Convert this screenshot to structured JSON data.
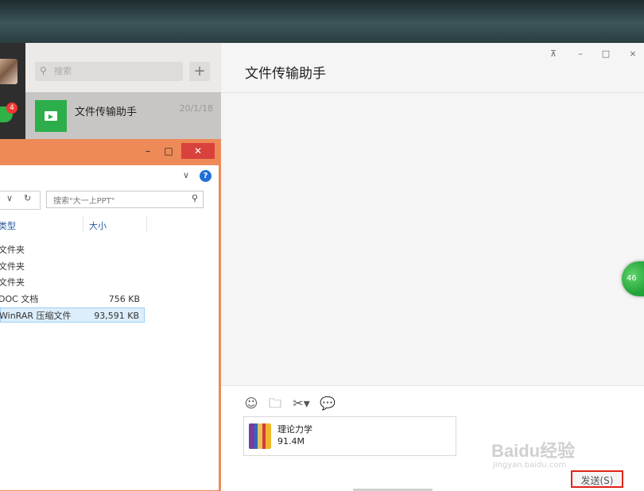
{
  "wechat": {
    "nav": {
      "badge_count": "4"
    },
    "search": {
      "placeholder": "搜索",
      "add_label": "+"
    },
    "chat_item": {
      "name": "文件传输助手",
      "date": "20/1/18"
    },
    "main": {
      "title": "文件传输助手",
      "window_controls": {
        "pin": "⊼",
        "minimize": "–",
        "maximize": "□",
        "close": "×"
      },
      "floating_badge": "46",
      "attachment": {
        "name": "理论力学",
        "size": "91.4M"
      },
      "send_label": "发送(S)"
    }
  },
  "explorer": {
    "window_controls": {
      "minimize": "–",
      "maximize": "□",
      "close": "✕"
    },
    "help_label": "?",
    "search_placeholder": "搜索\"大一上PPT\"",
    "columns": {
      "type": "类型",
      "size": "大小"
    },
    "rows": [
      {
        "type": "文件夹",
        "size": ""
      },
      {
        "type": "文件夹",
        "size": ""
      },
      {
        "type": "文件夹",
        "size": ""
      },
      {
        "type": "DOC 文档",
        "size": "756 KB"
      },
      {
        "type": "WinRAR 压缩文件",
        "size": "93,591 KB"
      }
    ]
  },
  "watermark": {
    "logo": "Baidu经验",
    "url": "jingyan.baidu.com"
  },
  "colors": {
    "accent_green": "#2cae4a",
    "explorer_frame": "#ee8a57",
    "highlight_red": "#e2231a",
    "badge_red": "#f43530"
  }
}
